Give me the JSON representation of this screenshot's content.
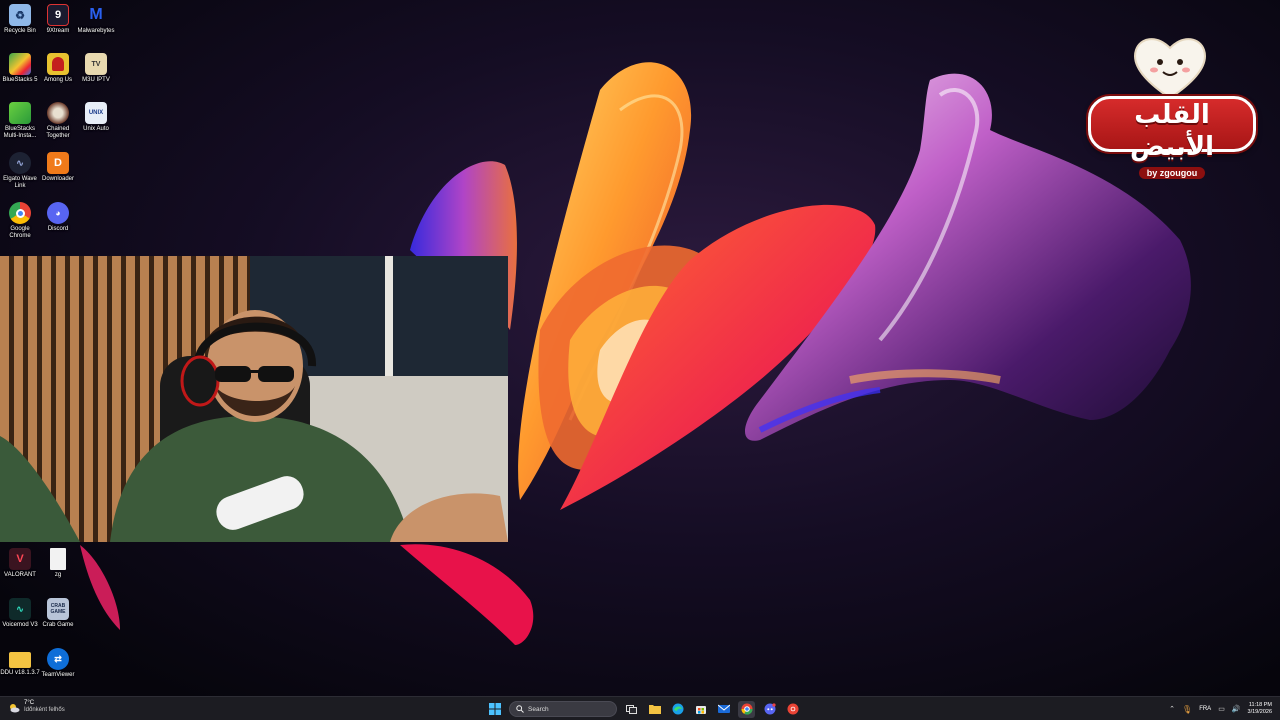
{
  "desktop": {
    "icons": [
      {
        "id": "recycle-bin",
        "label": "Recycle Bin",
        "icon": "recycle-bin-icon",
        "color": "#8fb8e8"
      },
      {
        "id": "9xtream",
        "label": "9Xtream",
        "icon": "9xtream-icon",
        "color": "#1a1a2e"
      },
      {
        "id": "malwarebytes",
        "label": "Malwarebytes",
        "icon": "malwarebytes-icon",
        "color": "#1f4fd6"
      },
      {
        "id": "bluestacks5",
        "label": "BlueStacks 5",
        "icon": "bluestacks-icon",
        "color": "#3aa64a"
      },
      {
        "id": "among-us",
        "label": "Among Us",
        "icon": "among-us-icon",
        "color": "#c41e1e"
      },
      {
        "id": "m3u-iptv",
        "label": "M3U IPTV",
        "icon": "m3u-iptv-icon",
        "color": "#e8d9b0"
      },
      {
        "id": "bluestacks-multi",
        "label": "BlueStacks Multi-Insta...",
        "icon": "bluestacks-multi-icon",
        "color": "#4ab848"
      },
      {
        "id": "chained-together",
        "label": "Chained Together",
        "icon": "chained-together-icon",
        "color": "#6b3a2a"
      },
      {
        "id": "unix-auto",
        "label": "Unix Auto",
        "icon": "unix-auto-icon",
        "color": "#e8eef8"
      },
      {
        "id": "elgato-wave",
        "label": "Elgato Wave Link",
        "icon": "elgato-wave-icon",
        "color": "#1d2233"
      },
      {
        "id": "downloader",
        "label": "Downloader",
        "icon": "downloader-icon",
        "color": "#f07a1a"
      },
      {
        "id": "google-chrome",
        "label": "Google Chrome",
        "icon": "chrome-icon",
        "color": "#4285f4"
      },
      {
        "id": "discord",
        "label": "Discord",
        "icon": "discord-icon",
        "color": "#5865f2"
      },
      {
        "id": "valorant",
        "label": "VALORANT",
        "icon": "valorant-icon",
        "color": "#3a1420"
      },
      {
        "id": "zg",
        "label": "zg",
        "icon": "file-icon",
        "color": "#f2f2f2"
      },
      {
        "id": "voicemod",
        "label": "Voicemod V3",
        "icon": "voicemod-icon",
        "color": "#0f2a2a"
      },
      {
        "id": "crab-game",
        "label": "Crab Game",
        "icon": "crab-game-icon",
        "color": "#b8c4d8"
      },
      {
        "id": "ddu",
        "label": "DDU v18.1.3.7",
        "icon": "folder-icon",
        "color": "#f3c342"
      },
      {
        "id": "teamviewer",
        "label": "TeamViewer",
        "icon": "teamviewer-icon",
        "color": "#0e6ed8"
      }
    ]
  },
  "overlay": {
    "logo_text": "القلب الأبيض",
    "logo_by": "by zgougou"
  },
  "taskbar": {
    "weather": {
      "temp": "7°C",
      "condition": "Időnként felhős"
    },
    "search_placeholder": "Search",
    "pinned": [
      {
        "name": "start-button",
        "icon": "windows-icon"
      },
      {
        "name": "task-view-button",
        "icon": "task-view-icon"
      },
      {
        "name": "file-explorer-button",
        "icon": "folder-icon"
      },
      {
        "name": "edge-button",
        "icon": "edge-icon"
      },
      {
        "name": "store-button",
        "icon": "store-icon"
      },
      {
        "name": "mail-button",
        "icon": "mail-icon"
      },
      {
        "name": "chrome-button",
        "icon": "chrome-icon",
        "active": true
      },
      {
        "name": "discord-taskbar-button",
        "icon": "discord-icon"
      },
      {
        "name": "chrome-alt-button",
        "icon": "chrome-icon"
      }
    ],
    "tray": {
      "language": "FRA",
      "time": "11:18 PM",
      "date": "3/19/2026"
    }
  }
}
